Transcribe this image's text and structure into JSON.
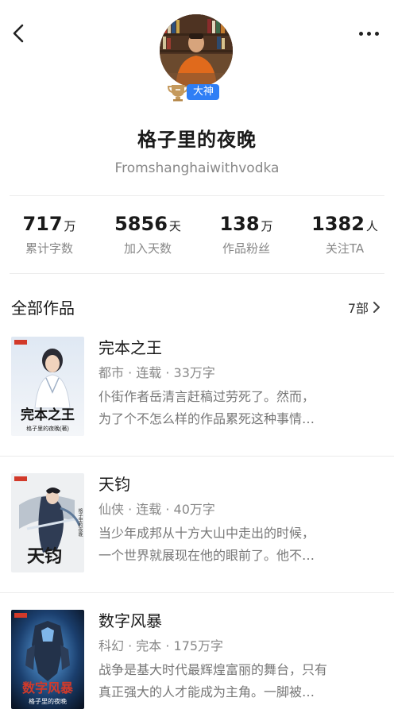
{
  "author": {
    "name": "格子里的夜晚",
    "motto": "Fromshanghaiwithvodka",
    "badge": "大神"
  },
  "stats": [
    {
      "value": "717",
      "unit": "万",
      "label": "累计字数"
    },
    {
      "value": "5856",
      "unit": "天",
      "label": "加入天数"
    },
    {
      "value": "138",
      "unit": "万",
      "label": "作品粉丝"
    },
    {
      "value": "1382",
      "unit": "人",
      "label": "关注TA"
    }
  ],
  "works": {
    "title": "全部作品",
    "count": "7部"
  },
  "books": [
    {
      "title": "完本之王",
      "meta": "都市 · 连载 · 33万字",
      "desc_line1": "仆街作者岳清言赶稿过劳死了。然而，",
      "desc_line2": "为了个不怎么样的作品累死这种事情…",
      "cover_title": "完本之王",
      "cover_author": "格子里的夜晚(著)"
    },
    {
      "title": "天钧",
      "meta": "仙侠 · 连载 · 40万字",
      "desc_line1": "当少年成邦从十方大山中走出的时候，",
      "desc_line2": "一个世界就展现在他的眼前了。他不…",
      "cover_title": "天钧",
      "cover_author": "格子里的夜晚"
    },
    {
      "title": "数字风暴",
      "meta": "科幻 · 完本 · 175万字",
      "desc_line1": "战争是基大时代最辉煌富丽的舞台，只有",
      "desc_line2": "真正强大的人才能成为主角。一脚被…",
      "cover_title": "数字风暴",
      "cover_author": "格子里的夜晚"
    }
  ],
  "icons": {
    "back": "chevron-left-icon",
    "more": "more-horizontal-icon",
    "arrow": "chevron-right-icon",
    "badge": "trophy-icon"
  },
  "colors": {
    "badge": "#2f7ef5",
    "muted_text": "#888888"
  }
}
